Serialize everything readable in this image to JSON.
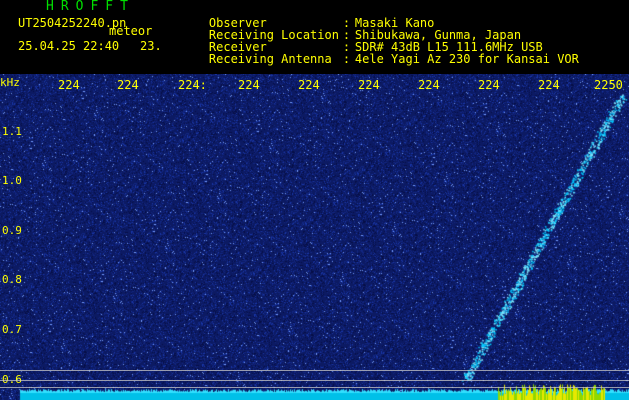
{
  "header": {
    "app_title": "HROFFT",
    "file_label": "UT2504252240.pn",
    "meteor_label": "meteor",
    "timestamp": "25.04.25 22:40",
    "count_label": "23.",
    "info": [
      {
        "label": "Observer",
        "value": "Masaki Kano"
      },
      {
        "label": "Receiving Location",
        "value": "Shibukawa, Gunma, Japan"
      },
      {
        "label": "Receiver",
        "value": "SDR# 43dB L15 111.6MHz USB"
      },
      {
        "label": "Receiving Antenna",
        "value": "4ele Yagi Az 230 for Kansai VOR"
      }
    ]
  },
  "spectrogram": {
    "y_unit": "kHz",
    "y_ticks": [
      "1.1",
      "1.0",
      "0.9",
      "0.8",
      "0.7",
      "0.6"
    ],
    "x_ticks": [
      "224",
      "224",
      "224:",
      "224",
      "224",
      "224",
      "224",
      "224",
      "224",
      "2250"
    ],
    "colors": {
      "background": "#0c1a63",
      "text": "#ffff00",
      "signal": "#00c8ff"
    }
  }
}
